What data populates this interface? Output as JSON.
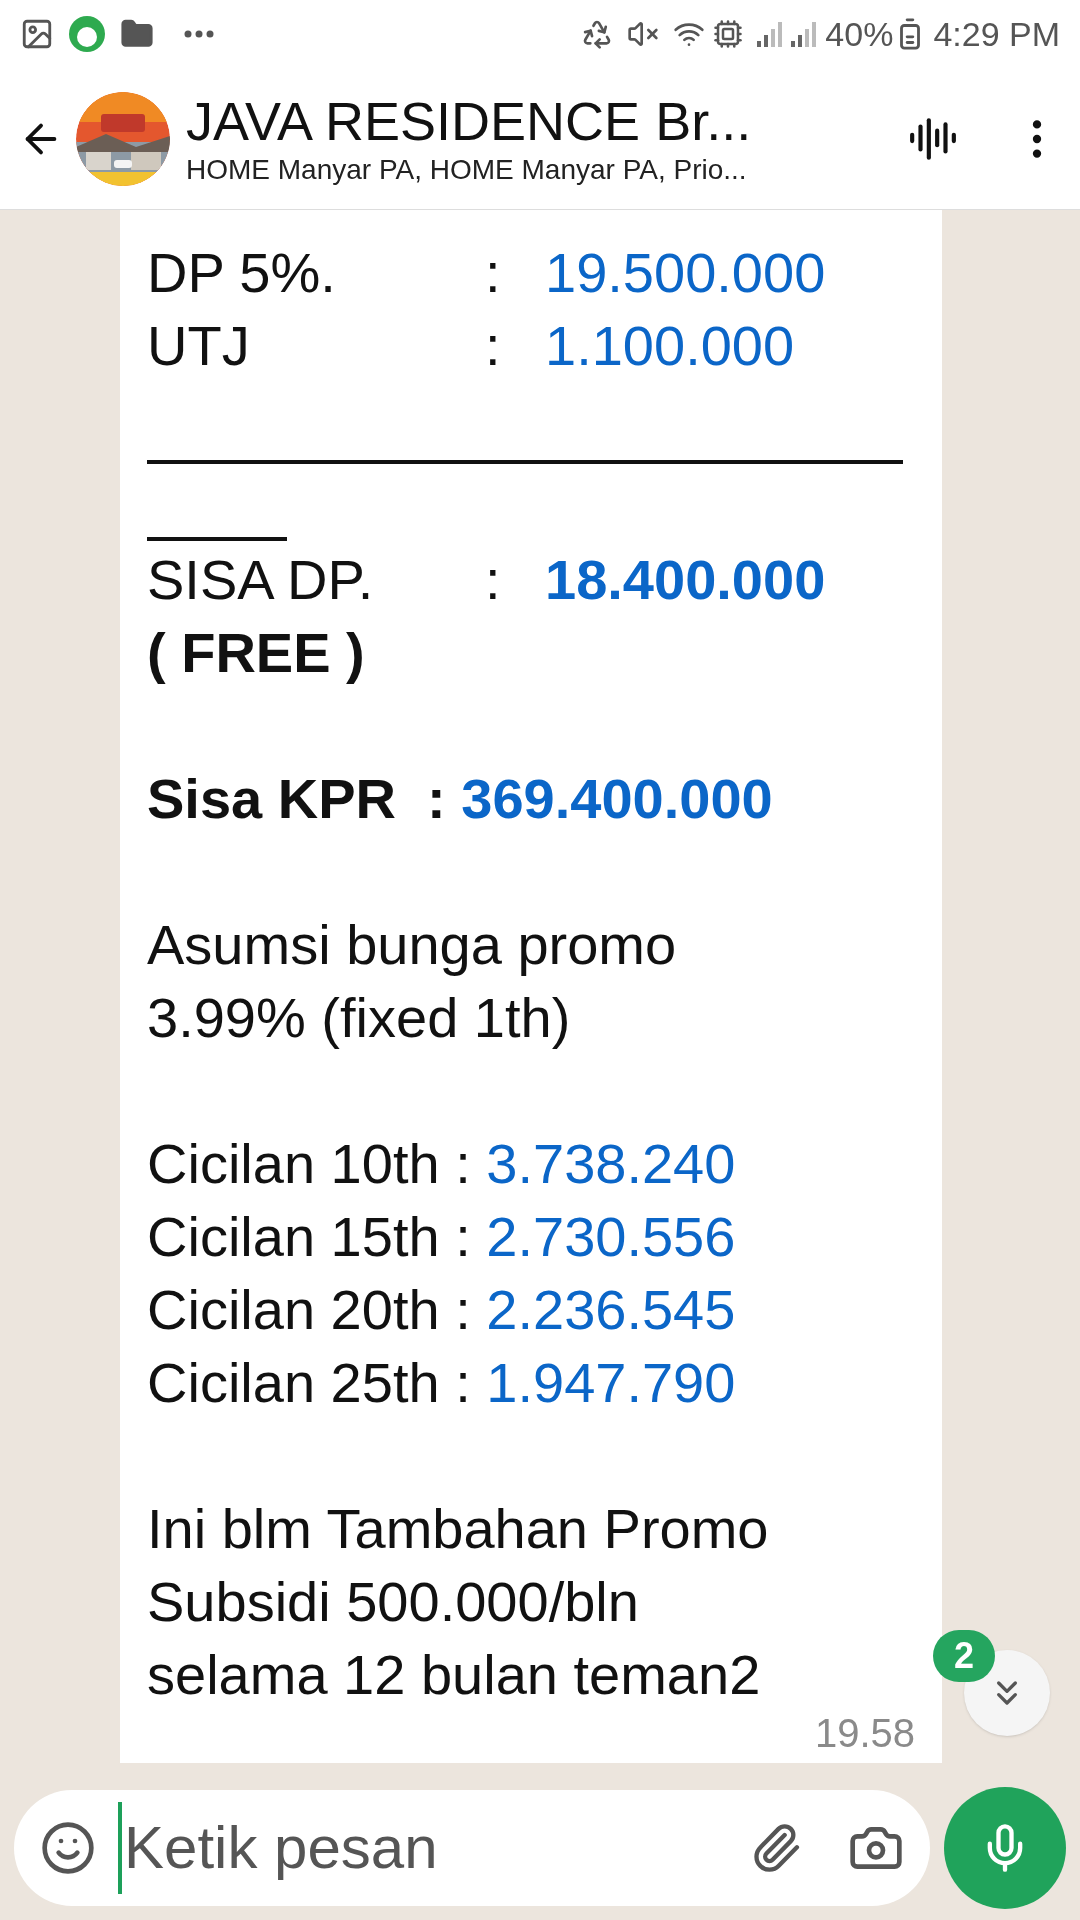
{
  "status_bar": {
    "battery": "40%",
    "time": "4:29 PM"
  },
  "header": {
    "title": "JAVA RESIDENCE Br...",
    "subtitle": "HOME Manyar PA, HOME Manyar PA, Prio..."
  },
  "message": {
    "lines": [
      {
        "kind": "row",
        "label": "DP 5%.",
        "colon": ":",
        "value": "19.500.000",
        "label_bold": false,
        "value_bold": false
      },
      {
        "kind": "row",
        "label": "UTJ",
        "colon": ":",
        "value": "1.100.000",
        "label_bold": false,
        "value_bold": false
      },
      {
        "kind": "rule"
      },
      {
        "kind": "short_rule"
      },
      {
        "kind": "row",
        "label": "SISA DP.",
        "colon": ":",
        "value": "18.400.000",
        "label_bold": false,
        "value_bold": true
      },
      {
        "kind": "text",
        "text": "( FREE )",
        "bold": true
      },
      {
        "kind": "blank"
      },
      {
        "kind": "inline",
        "label": "Sisa KPR  : ",
        "value": "369.400.000",
        "label_bold": true,
        "value_bold": true
      },
      {
        "kind": "blank"
      },
      {
        "kind": "text",
        "text": "Asumsi bunga promo\n3.99% (fixed 1th)",
        "bold": false
      },
      {
        "kind": "blank"
      },
      {
        "kind": "inline",
        "label": "Cicilan 10th : ",
        "value": "3.738.240",
        "label_bold": false,
        "value_bold": false
      },
      {
        "kind": "inline",
        "label": "Cicilan 15th : ",
        "value": "2.730.556",
        "label_bold": false,
        "value_bold": false
      },
      {
        "kind": "inline",
        "label": "Cicilan 20th : ",
        "value": "2.236.545",
        "label_bold": false,
        "value_bold": false
      },
      {
        "kind": "inline",
        "label": "Cicilan 25th : ",
        "value": "1.947.790",
        "label_bold": false,
        "value_bold": false
      },
      {
        "kind": "blank"
      },
      {
        "kind": "text",
        "text": "Ini blm Tambahan Promo\nSubsidi 500.000/bln\nselama 12 bulan teman2",
        "bold": false
      }
    ],
    "time": "19.58"
  },
  "scroll_button": {
    "badge": "2"
  },
  "composer": {
    "placeholder": "Ketik pesan"
  }
}
